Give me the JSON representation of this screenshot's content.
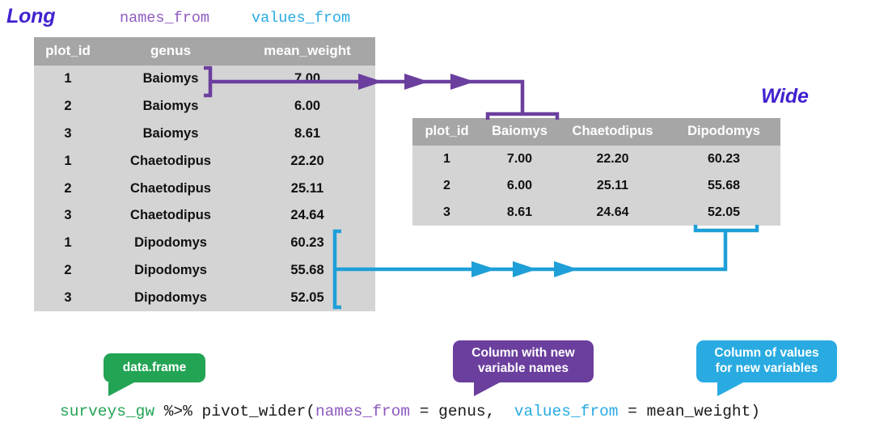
{
  "labels": {
    "long": "Long",
    "wide": "Wide",
    "names_from_arg": "names_from",
    "values_from_arg": "values_from"
  },
  "long_table": {
    "headers": [
      "plot_id",
      "genus",
      "mean_weight"
    ],
    "rows": [
      [
        "1",
        "Baiomys",
        "7.00"
      ],
      [
        "2",
        "Baiomys",
        "6.00"
      ],
      [
        "3",
        "Baiomys",
        "8.61"
      ],
      [
        "1",
        "Chaetodipus",
        "22.20"
      ],
      [
        "2",
        "Chaetodipus",
        "25.11"
      ],
      [
        "3",
        "Chaetodipus",
        "24.64"
      ],
      [
        "1",
        "Dipodomys",
        "60.23"
      ],
      [
        "2",
        "Dipodomys",
        "55.68"
      ],
      [
        "3",
        "Dipodomys",
        "52.05"
      ]
    ]
  },
  "wide_table": {
    "headers": [
      "plot_id",
      "Baiomys",
      "Chaetodipus",
      "Dipodomys"
    ],
    "rows": [
      [
        "1",
        "7.00",
        "22.20",
        "60.23"
      ],
      [
        "2",
        "6.00",
        "25.11",
        "55.68"
      ],
      [
        "3",
        "8.61",
        "24.64",
        "52.05"
      ]
    ]
  },
  "callouts": {
    "green": "data.frame",
    "purple_line1": "Column with new",
    "purple_line2": "variable names",
    "blue_line1": "Column of values",
    "blue_line2": "for new variables"
  },
  "code": {
    "data_frame": "surveys_gw",
    "pipe": " %>% ",
    "function_open": "pivot_wider(",
    "names_from": "names_from",
    "names_assign": " = genus,  ",
    "values_from": "values_from",
    "values_assign": " = mean_weight)"
  },
  "colors": {
    "purple_arrow": "#6b3f9e",
    "blue_arrow": "#1f9fd8",
    "green_callout": "#23a455",
    "purple_callout": "#6b3f9e",
    "blue_callout": "#29abe2",
    "section_label": "#4222d0",
    "table_header_bg": "#a6a6a6",
    "table_body_bg": "#d4d4d4",
    "names_from_text": "#8e5bbf",
    "values_from_text": "#29abe2"
  }
}
